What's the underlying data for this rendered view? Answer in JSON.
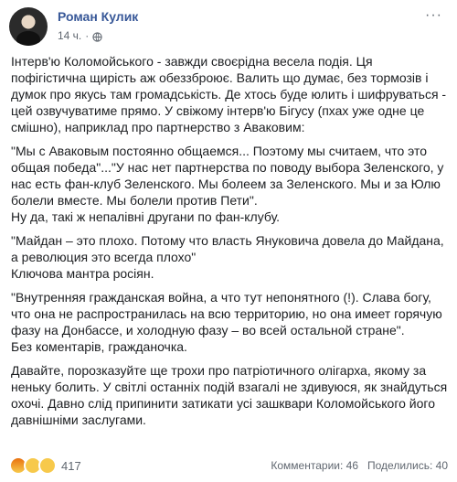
{
  "post": {
    "author": "Роман Кулик",
    "time": "14 ч.",
    "dot": "·",
    "more": "···",
    "paragraphs": [
      "Інтерв'ю Коломойського - завжди своєрідна весела подія. Ця пофігістична щирість аж обеззброює. Валить що думає, без тормозів і думок про якусь там громадськість. Де хтось буде юлить і шифруваться - цей озвучуватиме прямо. У свіжому інтерв'ю Бігусу (пхах уже одне це смішно), наприклад про партнерство з Аваковим:",
      "\"Мы с Аваковым постоянно общаемся... Поэтому мы считаем, что это общая победа\"...\"У нас нет партнерства по поводу выбора Зеленского, у нас есть фан-клуб Зеленского. Мы болеем за Зеленского. Мы и за Юлю болели вместе. Мы болели против Пети\".\nНу да, такі ж непалівні другани по фан-клубу.",
      "\"Майдан – это плохо. Потому что власть Януковича довела до Майдана, а революция это всегда плохо\"\nКлючова мантра росіян.",
      "\"Внутренняя гражданская война, а что тут непонятного (!). Слава богу, что она не распространилась на всю территорию, но она имеет горячую фазу на Донбассе, и холодную фазу – во всей остальной стране\".\nБез коментарів, гражданочка.",
      "Давайте, порозказуйте ще трохи про патріотичного олігарха, якому за неньку болить. У світлі останніх подій взагалі не здивуюся, як знайдуться охочі. Давно слід припинити затикати усі зашквари Коломойського його давнішніми заслугами."
    ],
    "reaction_count": "417",
    "comments": "Комментарии: 46",
    "shares": "Поделились: 40",
    "reaction_icons": [
      "angry-reaction-icon",
      "wow-reaction-icon",
      "haha-reaction-icon"
    ]
  }
}
